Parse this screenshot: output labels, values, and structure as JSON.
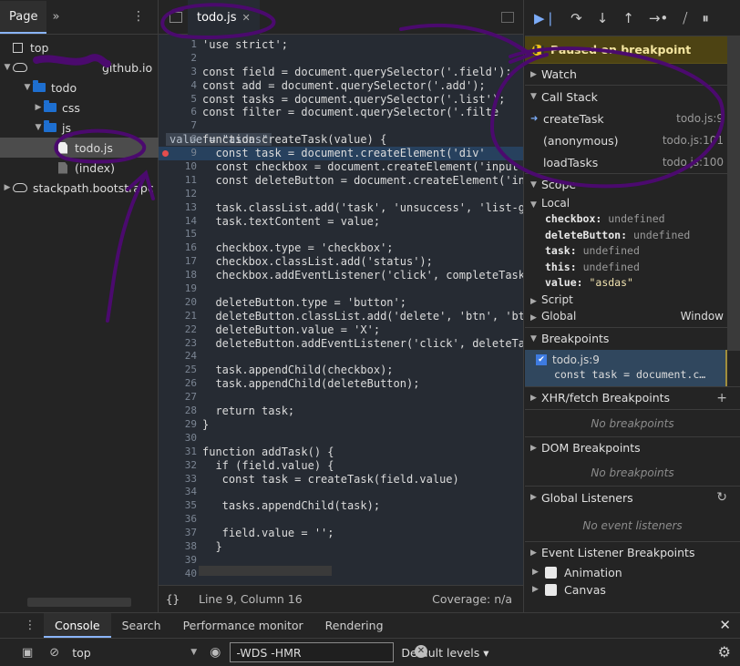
{
  "navigator": {
    "tab_page": "Page",
    "tab_more": "»",
    "menu": "⋮",
    "tree": [
      {
        "label": "top",
        "type": "frame",
        "indent": 0
      },
      {
        "label": "github.io",
        "type": "cloud",
        "indent": 1
      },
      {
        "label": "todo",
        "type": "folder",
        "indent": 2
      },
      {
        "label": "css",
        "type": "folder-closed",
        "indent": 3
      },
      {
        "label": "js",
        "type": "folder",
        "indent": 3
      },
      {
        "label": "todo.js",
        "type": "file",
        "indent": 4,
        "selected": true
      },
      {
        "label": "(index)",
        "type": "file-grey",
        "indent": 4
      },
      {
        "label": "stackpath.bootstrapc",
        "type": "cloud",
        "indent": 1
      }
    ]
  },
  "editor": {
    "tab_label": "todo.js",
    "tab_close": "✕",
    "lines": [
      {
        "n": "1",
        "code": "'use strict';"
      },
      {
        "n": "2",
        "code": ""
      },
      {
        "n": "3",
        "code": "const field = document.querySelector('.field');"
      },
      {
        "n": "4",
        "code": "const add = document.querySelector('.add');"
      },
      {
        "n": "5",
        "code": "const tasks = document.querySelector('.list');"
      },
      {
        "n": "6",
        "code": "const filter = document.querySelector('.filte"
      },
      {
        "n": "7",
        "code": ""
      },
      {
        "n": "8",
        "code": "function createTask(value) {",
        "inline": "value = \"asdas\""
      },
      {
        "n": "9",
        "code": "  const task = document.createElement('div'",
        "exec": true,
        "bp": true
      },
      {
        "n": "10",
        "code": "  const checkbox = document.createElement('input"
      },
      {
        "n": "11",
        "code": "  const deleteButton = document.createElement('in"
      },
      {
        "n": "12",
        "code": ""
      },
      {
        "n": "13",
        "code": "  task.classList.add('task', 'unsuccess', 'list-g"
      },
      {
        "n": "14",
        "code": "  task.textContent = value;"
      },
      {
        "n": "15",
        "code": ""
      },
      {
        "n": "16",
        "code": "  checkbox.type = 'checkbox';"
      },
      {
        "n": "17",
        "code": "  checkbox.classList.add('status');"
      },
      {
        "n": "18",
        "code": "  checkbox.addEventListener('click', completeTask"
      },
      {
        "n": "19",
        "code": ""
      },
      {
        "n": "20",
        "code": "  deleteButton.type = 'button';"
      },
      {
        "n": "21",
        "code": "  deleteButton.classList.add('delete', 'btn', 'bt"
      },
      {
        "n": "22",
        "code": "  deleteButton.value = 'X';"
      },
      {
        "n": "23",
        "code": "  deleteButton.addEventListener('click', deleteTa"
      },
      {
        "n": "24",
        "code": ""
      },
      {
        "n": "25",
        "code": "  task.appendChild(checkbox);"
      },
      {
        "n": "26",
        "code": "  task.appendChild(deleteButton);"
      },
      {
        "n": "27",
        "code": ""
      },
      {
        "n": "28",
        "code": "  return task;"
      },
      {
        "n": "29",
        "code": "}"
      },
      {
        "n": "30",
        "code": ""
      },
      {
        "n": "31",
        "code": "function addTask() {"
      },
      {
        "n": "32",
        "code": "  if (field.value) {"
      },
      {
        "n": "33",
        "code": "   const task = createTask(field.value)"
      },
      {
        "n": "34",
        "code": ""
      },
      {
        "n": "35",
        "code": "   tasks.appendChild(task);"
      },
      {
        "n": "36",
        "code": ""
      },
      {
        "n": "37",
        "code": "   field.value = '';"
      },
      {
        "n": "38",
        "code": "  }"
      },
      {
        "n": "39",
        "code": ""
      },
      {
        "n": "40",
        "code": ""
      }
    ],
    "status": {
      "braces": "{}",
      "position": "Line 9, Column 16",
      "coverage": "Coverage: n/a"
    }
  },
  "debugger": {
    "paused_text": "Paused on breakpoint",
    "watch": "Watch",
    "call_stack": "Call Stack",
    "frames": [
      {
        "name": "createTask",
        "loc": "todo.js:9",
        "current": true
      },
      {
        "name": "(anonymous)",
        "loc": "todo.js:101"
      },
      {
        "name": "loadTasks",
        "loc": "todo.js:100"
      }
    ],
    "scope": "Scope",
    "local": "Local",
    "locals": [
      {
        "k": "checkbox:",
        "v": "undefined"
      },
      {
        "k": "deleteButton:",
        "v": "undefined"
      },
      {
        "k": "task:",
        "v": "undefined"
      },
      {
        "k": "this:",
        "v": "undefined"
      },
      {
        "k": "value:",
        "v": "\"asdas\"",
        "str": true
      }
    ],
    "script": "Script",
    "global": "Global",
    "global_val": "Window",
    "breakpoints": "Breakpoints",
    "bp_file": "todo.js:9",
    "bp_code": "const task = document.c…",
    "xhr": "XHR/fetch Breakpoints",
    "xhr_empty": "No breakpoints",
    "dom": "DOM Breakpoints",
    "dom_empty": "No breakpoints",
    "global_listeners": "Global Listeners",
    "gl_empty": "No event listeners",
    "event_bp": "Event Listener Breakpoints",
    "event_items": [
      "Animation",
      "Canvas"
    ]
  },
  "drawer": {
    "tabs": [
      "Console",
      "Search",
      "Performance monitor",
      "Rendering"
    ],
    "context": "top",
    "filter_value": "-WDS -HMR",
    "levels": "Default levels ▾"
  },
  "colors": {
    "annotation": "#4b0a6e",
    "exec_line": "#27415e",
    "paused_bg": "#4d4313",
    "accent": "#8ab4f8"
  }
}
